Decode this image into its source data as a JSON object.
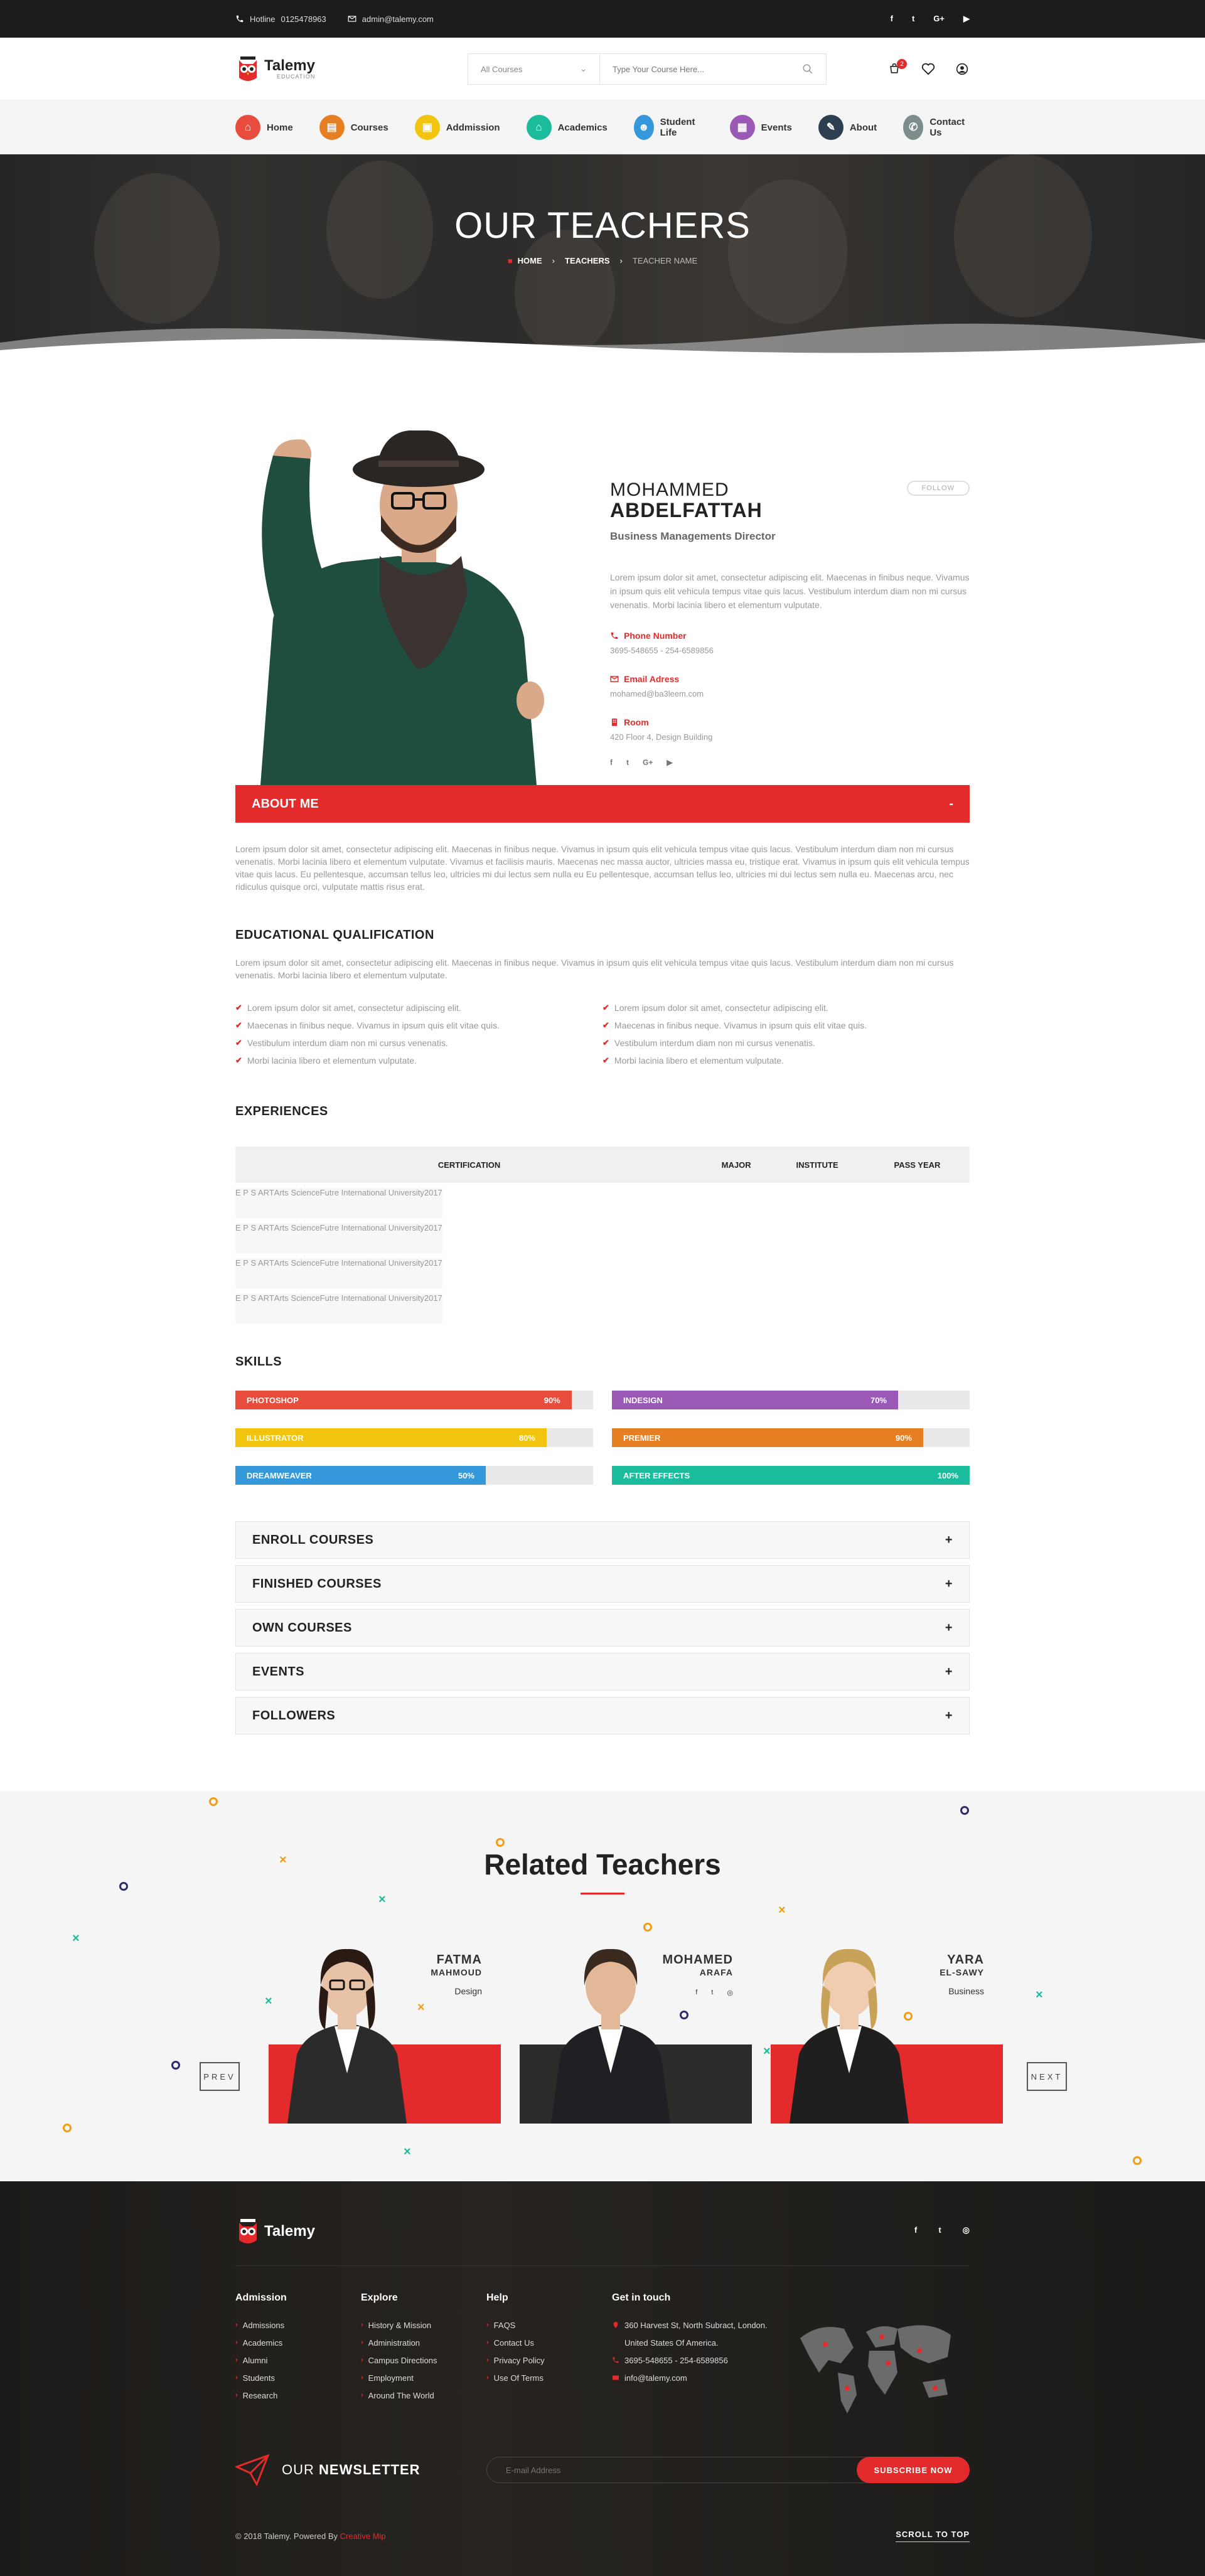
{
  "topbar": {
    "hotline_label": "Hotline",
    "hotline_number": "0125478963",
    "email": "admin@talemy.com",
    "socials": [
      "f",
      "t",
      "G+",
      "▶"
    ]
  },
  "header": {
    "logo_name": "Talemy",
    "logo_sub": "EDUCATION",
    "category_select": "All Courses",
    "search_placeholder": "Type Your Course Here...",
    "cart_count": "2"
  },
  "nav": [
    {
      "label": "Home",
      "color": "#e74c3c",
      "icon": "⌂"
    },
    {
      "label": "Courses",
      "color": "#e67e22",
      "icon": "▤"
    },
    {
      "label": "Addmission",
      "color": "#f1c40f",
      "icon": "▣"
    },
    {
      "label": "Academics",
      "color": "#1abc9c",
      "icon": "⌂"
    },
    {
      "label": "Student Life",
      "color": "#3498db",
      "icon": "☻"
    },
    {
      "label": "Events",
      "color": "#9b59b6",
      "icon": "▦"
    },
    {
      "label": "About",
      "color": "#2c3e50",
      "icon": "✎"
    },
    {
      "label": "Contact Us",
      "color": "#7f8c8d",
      "icon": "✆"
    }
  ],
  "hero": {
    "title": "OUR TEACHERS",
    "crumb_home": "HOME",
    "crumb_teachers": "TEACHERS",
    "crumb_current": "TEACHER NAME"
  },
  "profile": {
    "first_name": "MOHAMMED",
    "last_name": "ABDELFATTAH",
    "role": "Business Managements Director",
    "follow": "FOLLOW",
    "bio": "Lorem ipsum dolor sit amet, consectetur adipiscing elit. Maecenas in finibus neque. Vivamus in ipsum quis elit vehicula tempus vitae quis lacus. Vestibulum interdum diam non mi cursus venenatis. Morbi lacinia libero et elementum vulputate.",
    "phone_label": "Phone Number",
    "phone_value": "3695-548655  -  254-6589856",
    "email_label": "Email Adress",
    "email_value": "mohamed@ba3leem.com",
    "room_label": "Room",
    "room_value": "420 Floor 4, Design Building",
    "socials": [
      "f",
      "t",
      "G+",
      "▶"
    ]
  },
  "about": {
    "title": "ABOUT ME",
    "toggle": "-",
    "text": "Lorem ipsum dolor sit amet, consectetur adipiscing elit. Maecenas in finibus neque. Vivamus in ipsum quis elit vehicula tempus vitae quis lacus. Vestibulum interdum diam non mi cursus venenatis. Morbi lacinia libero et elementum vulputate. Vivamus et facilisis mauris. Maecenas nec massa auctor, ultricies massa eu, tristique erat. Vivamus in ipsum quis elit vehicula tempus vitae quis lacus. Eu pellentesque, accumsan tellus leo, ultricies mi dui lectus sem nulla eu Eu pellentesque, accumsan tellus leo, ultricies mi dui lectus sem nulla eu. Maecenas arcu, nec ridiculus quisque orci, vulputate mattis risus erat."
  },
  "education": {
    "title": "EDUCATIONAL QUALIFICATION",
    "text": "Lorem ipsum dolor sit amet, consectetur adipiscing elit. Maecenas in finibus neque. Vivamus in ipsum quis elit vehicula tempus vitae quis lacus. Vestibulum interdum diam non mi cursus venenatis. Morbi lacinia libero et elementum vulputate.",
    "left": [
      "Lorem ipsum dolor sit amet, consectetur adipiscing elit.",
      "Maecenas in finibus neque. Vivamus in ipsum quis elit vitae quis.",
      "Vestibulum interdum diam non mi cursus venenatis.",
      "Morbi lacinia libero et elementum vulputate."
    ],
    "right": [
      "Lorem ipsum dolor sit amet, consectetur adipiscing elit.",
      "Maecenas in finibus neque. Vivamus in ipsum quis elit vitae quis.",
      "Vestibulum interdum diam non mi cursus venenatis.",
      "Morbi lacinia libero et elementum vulputate."
    ]
  },
  "experiences": {
    "title": "EXPERIENCES",
    "headers": [
      "CERTIFICATION",
      "MAJOR",
      "INSTITUTE",
      "PASS YEAR"
    ],
    "rows": [
      [
        "E P S ART",
        "Arts Science",
        "Futre International University",
        "2017"
      ],
      [
        "E P S ART",
        "Arts Science",
        "Futre International University",
        "2017"
      ],
      [
        "E P S ART",
        "Arts Science",
        "Futre International University",
        "2017"
      ],
      [
        "E P S ART",
        "Arts Science",
        "Futre International University",
        "2017"
      ]
    ]
  },
  "skills": {
    "title": "SKILLS",
    "left": [
      {
        "name": "PHOTOSHOP",
        "percent": 94,
        "label": "90%",
        "color": "#e74c3c"
      },
      {
        "name": "ILLUSTRATOR",
        "percent": 87,
        "label": "80%",
        "color": "#f1c40f"
      },
      {
        "name": "DREAMWEAVER",
        "percent": 70,
        "label": "50%",
        "color": "#3498db"
      }
    ],
    "right": [
      {
        "name": "INDESIGN",
        "percent": 80,
        "label": "70%",
        "color": "#9b59b6"
      },
      {
        "name": "PREMIER",
        "percent": 87,
        "label": "90%",
        "color": "#e67e22"
      },
      {
        "name": "AFTER EFFECTS",
        "percent": 100,
        "label": "100%",
        "color": "#1abc9c"
      }
    ]
  },
  "accordion": [
    "ENROLL COURSES",
    "FINISHED COURSES",
    "OWN COURSES",
    "EVENTS",
    "FOLLOWERS"
  ],
  "related": {
    "title": "Related Teachers",
    "prev": "PREV",
    "next": "NEXT",
    "teachers": [
      {
        "first": "FATMA",
        "last": "MAHMOUD",
        "dept": "Design",
        "color": "#e32b2b"
      },
      {
        "first": "MOHAMED",
        "last": "ARAFA",
        "dept": "",
        "color": "#2b2b2b"
      },
      {
        "first": "YARA",
        "last": "EL-SAWY",
        "dept": "Business",
        "color": "#e32b2b"
      }
    ],
    "card_socials": [
      "f",
      "t",
      "◎"
    ]
  },
  "footer": {
    "logo_name": "Talemy",
    "socials": [
      "f",
      "t",
      "◎"
    ],
    "columns": [
      {
        "title": "Admission",
        "items": [
          "Admissions",
          "Academics",
          "Alumni",
          "Students",
          "Research"
        ]
      },
      {
        "title": "Explore",
        "items": [
          "History & Mission",
          "Administration",
          "Campus Directions",
          "Employment",
          "Around The World"
        ]
      },
      {
        "title": "Help",
        "items": [
          "FAQS",
          "Contact Us",
          "Privacy Policy",
          "Use Of Terms"
        ]
      }
    ],
    "touch_title": "Get in touch",
    "address1": "360 Harvest St, North Subract, London.",
    "address2": "United States Of America.",
    "phone": "3695-548655  -  254-6589856",
    "email": "info@talemy.com",
    "newsletter_our": "OUR",
    "newsletter_word": "NEWSLETTER",
    "email_placeholder": "E-mail Address",
    "subscribe": "SUBSCRIBE NOW",
    "copyright": "© 2018 Talemy.  Powered By",
    "powered": "Creative Mip",
    "scroll_top": "SCROLL TO TOP"
  }
}
